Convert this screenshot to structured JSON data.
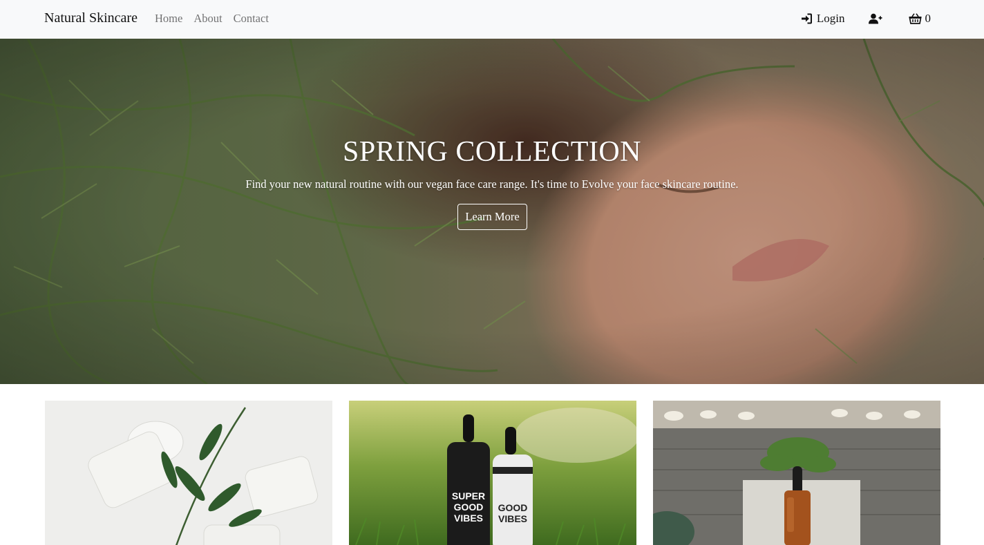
{
  "navbar": {
    "brand": "Natural Skincare",
    "links": [
      "Home",
      "About",
      "Contact"
    ],
    "login_label": "Login",
    "login_icon": "sign-in-icon",
    "register_icon": "user-plus-icon",
    "cart_icon": "shopping-basket-icon",
    "cart_count": "0"
  },
  "hero": {
    "title": "SPRING COLLECTION",
    "subtitle": "Find your new natural routine with our vegan face care range. It's time to Evolve your face skincare routine.",
    "button_label": "Learn More"
  },
  "products": [
    {
      "image": "cream-jars-with-leaves-image"
    },
    {
      "image": "serum-bottles-on-grass-image"
    },
    {
      "image": "amber-dropper-bottle-on-table-image"
    }
  ],
  "colors": {
    "navbar_bg": "#f8f9fa",
    "hero_text": "#ffffff",
    "nav_link": "#6c6f73"
  }
}
